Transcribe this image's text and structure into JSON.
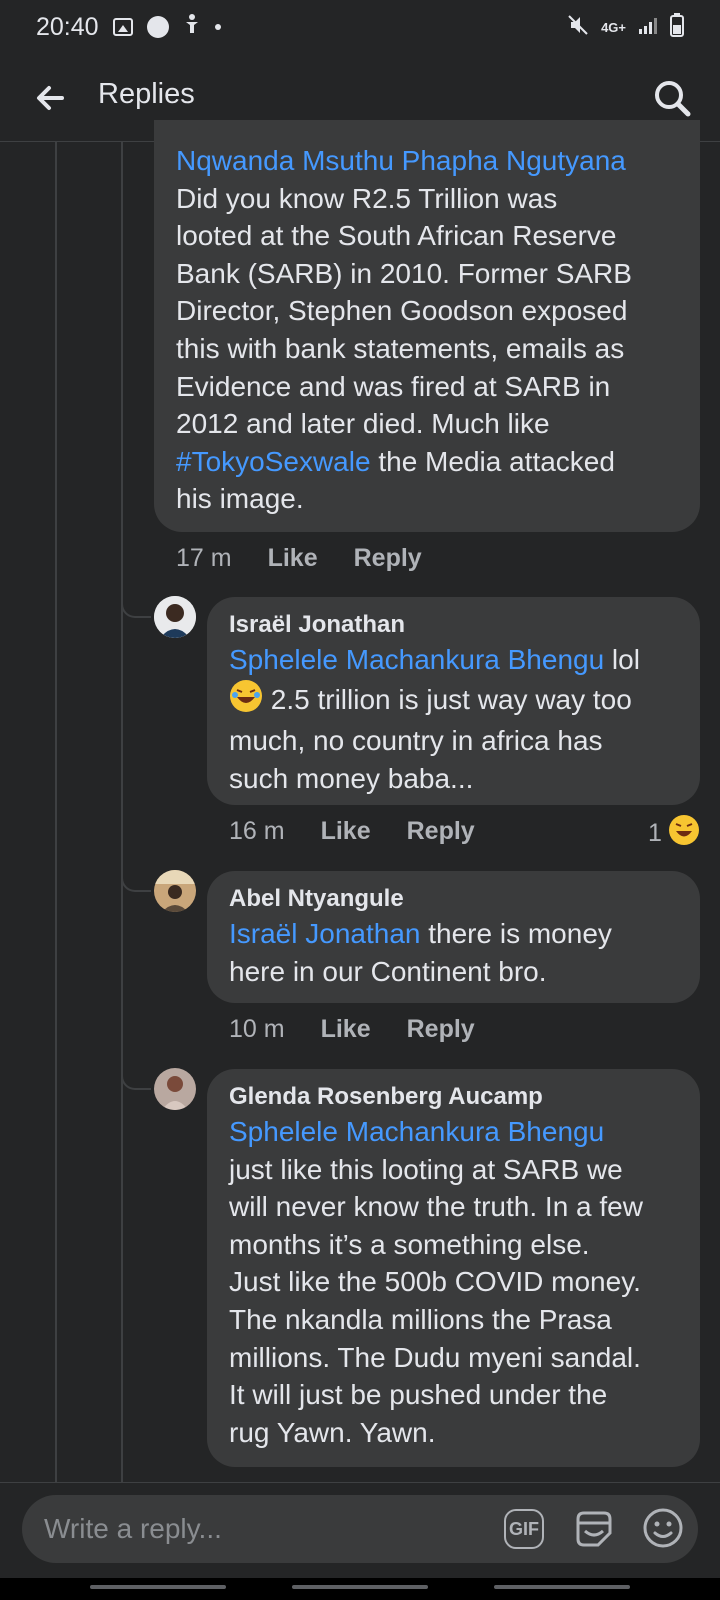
{
  "status_bar": {
    "time": "20:40",
    "network": "4G+",
    "icons": [
      "gallery-icon",
      "messenger-icon",
      "accessibility-icon",
      "dot-icon",
      "mute-icon",
      "network-icon",
      "signal-icon",
      "battery-icon"
    ]
  },
  "header": {
    "title": "Replies",
    "back_icon": "back-arrow-icon",
    "search_icon": "search-icon"
  },
  "comments": [
    {
      "mention": "Nqwanda Msuthu Phapha Ngutyana",
      "text_lines": [
        "Did you know R2.5 Trillion was",
        "looted at the South African Reserve",
        "Bank (SARB) in 2010. Former SARB",
        "Director, Stephen Goodson exposed",
        "this with bank statements, emails as",
        "Evidence and was fired at SARB in",
        "2012 and later died. Much like"
      ],
      "hashtag": "#TokyoSexwale",
      "after_hashtag": " the Media attacked",
      "last_line": "his image.",
      "time": "17 m",
      "like": "Like",
      "reply": "Reply"
    },
    {
      "author": "Israël Jonathan",
      "mention": "Sphelele Machankura Bhengu",
      "after_mention": " lol",
      "line2": " 2.5 trillion is just way way too",
      "line3": "much, no country in africa has",
      "line4": "such money baba...",
      "time": "16 m",
      "like": "Like",
      "reply": "Reply",
      "reaction_count": "1"
    },
    {
      "author": "Abel Ntyangule",
      "mention": "Israël Jonathan",
      "after_mention": " there is money",
      "line2": "here in our Continent bro.",
      "time": "10 m",
      "like": "Like",
      "reply": "Reply"
    },
    {
      "author": "Glenda Rosenberg Aucamp",
      "mention": "Sphelele Machankura Bhengu",
      "text_lines": [
        "just like this looting at SARB we",
        "will never know the truth. In a few",
        "months it’s a something else.",
        "Just like the 500b COVID money.",
        "The nkandla millions the Prasa",
        "millions. The Dudu myeni sandal.",
        "It will just be pushed under the",
        "rug   Yawn. Yawn."
      ]
    }
  ],
  "composer": {
    "placeholder": "Write a reply...",
    "gif_label": "GIF"
  },
  "colors": {
    "background": "#242526",
    "bubble": "#3a3b3c",
    "mention": "#4599ff",
    "text": "#e4e6eb",
    "muted": "#b0b3b8"
  }
}
